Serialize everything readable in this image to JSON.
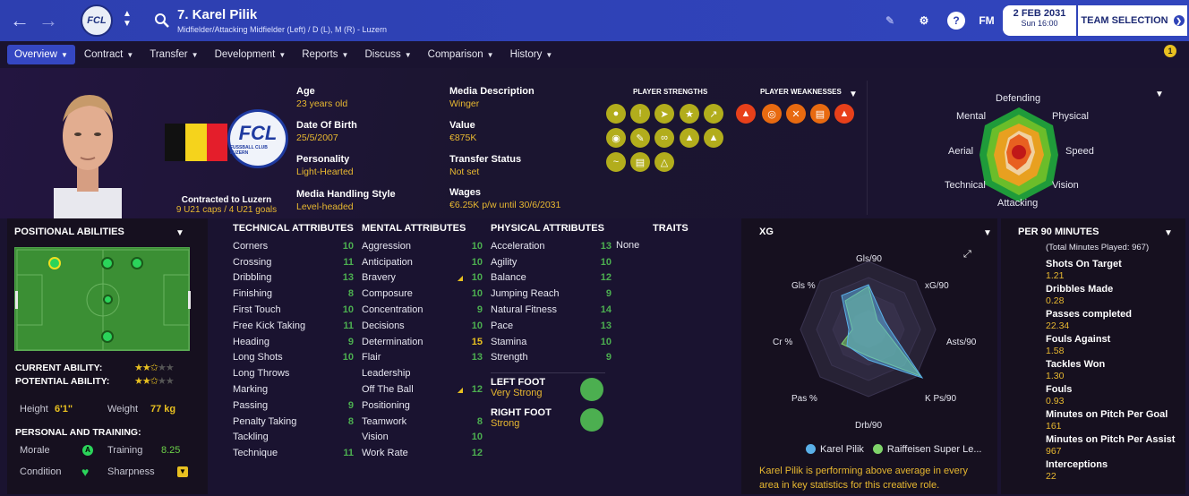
{
  "topbar": {
    "player_title": "7. Karel Pilik",
    "player_subtitle": "Midfielder/Attacking Midfielder (Left) / D (L), M (R) - Luzern",
    "club_badge": "FCL",
    "fm_label": "FM",
    "date": "2 FEB 2031",
    "time": "Sun 16:00",
    "team_selection": "TEAM SELECTION",
    "notification_count": "1"
  },
  "menu": [
    {
      "label": "Overview"
    },
    {
      "label": "Contract"
    },
    {
      "label": "Transfer"
    },
    {
      "label": "Development"
    },
    {
      "label": "Reports"
    },
    {
      "label": "Discuss"
    },
    {
      "label": "Comparison"
    },
    {
      "label": "History"
    }
  ],
  "club_logo": {
    "text": "FCL",
    "subtext": "FUSSBALL CLUB LUZERN"
  },
  "flag_colors": [
    "#111111",
    "#f5d31c",
    "#e41e2b"
  ],
  "contract": {
    "title": "Contracted to Luzern",
    "caps": "9 U21 caps / 4 U21 goals"
  },
  "info": {
    "age_label": "Age",
    "age": "23 years old",
    "dob_label": "Date Of Birth",
    "dob": "25/5/2007",
    "personality_label": "Personality",
    "personality": "Light-Hearted",
    "media_style_label": "Media Handling Style",
    "media_style": "Level-headed",
    "media_desc_label": "Media Description",
    "media_desc": "Winger",
    "value_label": "Value",
    "value": "€875K",
    "transfer_label": "Transfer Status",
    "transfer": "Not set",
    "wages_label": "Wages",
    "wages": "€6.25K p/w until 30/6/2031"
  },
  "strengths_title": "PLAYER STRENGTHS",
  "weaknesses_title": "PLAYER WEAKNESSES",
  "strength_icons": [
    "dribble-icon",
    "shot-icon",
    "pass-icon",
    "star-icon",
    "arrow-icon",
    "head-icon",
    "fitness-icon",
    "flair-icon",
    "feet-icon",
    "cone-icon",
    "wave-icon",
    "pitch-icon",
    "flask-icon"
  ],
  "weakness_icons": [
    "cone-ball-icon",
    "target-icon",
    "tackle-icon",
    "goal-icon",
    "cone-ball-2-icon"
  ],
  "top_radar": {
    "labels": [
      "Defending",
      "Physical",
      "Speed",
      "Vision",
      "Attacking",
      "Technical",
      "Aerial",
      "Mental"
    ]
  },
  "positional": {
    "title": "POSITIONAL ABILITIES",
    "current_label": "CURRENT ABILITY:",
    "potential_label": "POTENTIAL ABILITY:",
    "current_stars": 2.5,
    "potential_stars": 2.5,
    "height_label": "Height",
    "height": "6'1\"",
    "weight_label": "Weight",
    "weight": "77 kg",
    "pt_title": "PERSONAL AND TRAINING:",
    "morale_label": "Morale",
    "training_label": "Training",
    "training": "8.25",
    "condition_label": "Condition",
    "sharpness_label": "Sharpness"
  },
  "technical": {
    "title": "TECHNICAL ATTRIBUTES",
    "rows": [
      {
        "n": "Corners",
        "v": "10"
      },
      {
        "n": "Crossing",
        "v": "11"
      },
      {
        "n": "Dribbling",
        "v": "13"
      },
      {
        "n": "Finishing",
        "v": "8"
      },
      {
        "n": "First Touch",
        "v": "10"
      },
      {
        "n": "Free Kick Taking",
        "v": "11"
      },
      {
        "n": "Heading",
        "v": "9"
      },
      {
        "n": "Long Shots",
        "v": "10"
      },
      {
        "n": "Long Throws",
        "v": ""
      },
      {
        "n": "Marking",
        "v": ""
      },
      {
        "n": "Passing",
        "v": "9"
      },
      {
        "n": "Penalty Taking",
        "v": "8"
      },
      {
        "n": "Tackling",
        "v": ""
      },
      {
        "n": "Technique",
        "v": "11"
      }
    ]
  },
  "mental": {
    "title": "MENTAL ATTRIBUTES",
    "rows": [
      {
        "n": "Aggression",
        "v": "10"
      },
      {
        "n": "Anticipation",
        "v": "10"
      },
      {
        "n": "Bravery",
        "v": "10"
      },
      {
        "n": "Composure",
        "v": "10"
      },
      {
        "n": "Concentration",
        "v": "9"
      },
      {
        "n": "Decisions",
        "v": "10"
      },
      {
        "n": "Determination",
        "v": "15"
      },
      {
        "n": "Flair",
        "v": "13"
      },
      {
        "n": "Leadership",
        "v": ""
      },
      {
        "n": "Off The Ball",
        "v": "12"
      },
      {
        "n": "Positioning",
        "v": ""
      },
      {
        "n": "Teamwork",
        "v": "8"
      },
      {
        "n": "Vision",
        "v": "10"
      },
      {
        "n": "Work Rate",
        "v": "12"
      }
    ]
  },
  "physical": {
    "title": "PHYSICAL ATTRIBUTES",
    "rows": [
      {
        "n": "Acceleration",
        "v": "13"
      },
      {
        "n": "Agility",
        "v": "10"
      },
      {
        "n": "Balance",
        "v": "12"
      },
      {
        "n": "Jumping Reach",
        "v": "9"
      },
      {
        "n": "Natural Fitness",
        "v": "14"
      },
      {
        "n": "Pace",
        "v": "13"
      },
      {
        "n": "Stamina",
        "v": "10"
      },
      {
        "n": "Strength",
        "v": "9"
      }
    ]
  },
  "feet": {
    "left_label": "LEFT FOOT",
    "left": "Very Strong",
    "right_label": "RIGHT FOOT",
    "right": "Strong"
  },
  "traits": {
    "title": "TRAITS",
    "value": "None"
  },
  "xg": {
    "title": "XG",
    "labels": [
      "Gls/90",
      "xG/90",
      "Asts/90",
      "K Ps/90",
      "Drb/90",
      "Pas %",
      "Cr %",
      "Gls %"
    ],
    "legend_player": "Karel Pilik",
    "legend_league": "Raiffeisen Super Le...",
    "player_color": "#5ab0e8",
    "league_color": "#7fd36a",
    "description": "Karel Pilik is performing above average in every area in key statistics for this creative role."
  },
  "per90": {
    "title": "PER 90 MINUTES",
    "total": "(Total Minutes Played: 967)",
    "rows": [
      {
        "n": "Shots On Target",
        "v": "1.21"
      },
      {
        "n": "Dribbles Made",
        "v": "0.28"
      },
      {
        "n": "Passes completed",
        "v": "22.34"
      },
      {
        "n": "Fouls Against",
        "v": "1.58"
      },
      {
        "n": "Tackles Won",
        "v": "1.30"
      },
      {
        "n": "Fouls",
        "v": "0.93"
      },
      {
        "n": "Minutes on Pitch Per Goal",
        "v": "161"
      },
      {
        "n": "Minutes on Pitch Per Assist",
        "v": "967"
      },
      {
        "n": "Interceptions",
        "v": "22"
      }
    ]
  }
}
